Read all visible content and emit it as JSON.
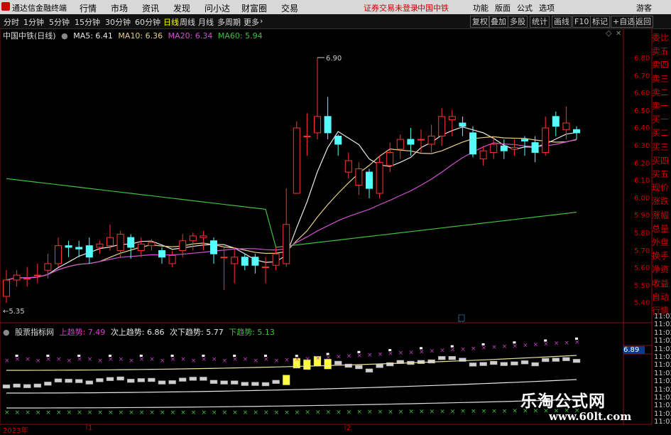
{
  "window": {
    "app_name": "通达信金融终端"
  },
  "menu": {
    "items": [
      "行情",
      "市场",
      "资讯",
      "发现",
      "问小达",
      "财富圈",
      "交易"
    ],
    "notice": "证券交易未登录",
    "stock": "中国中铁",
    "right": [
      "功能",
      "版面",
      "公式",
      "选项"
    ],
    "guest": "游客"
  },
  "toolbar": {
    "periods": [
      "分时",
      "1分钟",
      "5分钟",
      "15分钟",
      "30分钟",
      "60分钟",
      "日线",
      "周线",
      "月线",
      "多周期",
      "更多"
    ],
    "active_period": "日线",
    "right_buttons": [
      "复权",
      "叠加",
      "多股",
      "统计",
      "画线",
      "F10",
      "标记",
      "+自选",
      "返回"
    ]
  },
  "chart": {
    "stock_label": "中国中铁(日线)",
    "ma": [
      {
        "label": "MA5: 6.41",
        "color": "#e8e8e8"
      },
      {
        "label": "MA10: 6.36",
        "color": "#e6d08a"
      },
      {
        "label": "MA20: 6.34",
        "color": "#d050d0"
      },
      {
        "label": "MA60: 5.94",
        "color": "#40c040"
      }
    ],
    "high_label": "6.90",
    "low_label": "5.35",
    "event_mark": "解",
    "y_ticks": [
      "6.80",
      "6.70",
      "6.60",
      "6.50",
      "6.40",
      "6.30",
      "6.20",
      "6.10",
      "6.00",
      "5.90",
      "5.80",
      "5.70",
      "5.60",
      "5.50",
      "5.40"
    ]
  },
  "indicator": {
    "name": "股票指标网",
    "items": [
      {
        "label": "上趋势: 7.49",
        "color": "#d040d0"
      },
      {
        "label": "次上趋势: 6.86",
        "color": "#e8e8e8"
      },
      {
        "label": "次下趋势: 5.77",
        "color": "#e8e8e8"
      },
      {
        "label": "下趋势: 5.13",
        "color": "#40c040"
      }
    ],
    "cursor_value": "6.89"
  },
  "xaxis": {
    "labels": [
      "2023年",
      "1",
      "2"
    ]
  },
  "right_panel": {
    "items": [
      "委比",
      "卖五",
      "卖四",
      "卖三",
      "卖二",
      "卖一",
      "买一",
      "买二",
      "买三",
      "买四",
      "买五",
      "现价",
      "涨跌",
      "涨幅",
      "总量",
      "外盘",
      "换手",
      "净资",
      "收益",
      "自动",
      "行情"
    ],
    "times": [
      "11:02",
      "11:02",
      "11:02",
      "11:02",
      "11:02",
      "11:02",
      "11:02",
      "11:02",
      "11:02",
      "11:02",
      "11:02",
      "11:02",
      "11:02",
      "11:02"
    ]
  },
  "watermark": {
    "title": "乐淘公式网",
    "url": "www.60lt.com"
  },
  "chart_data": {
    "type": "candlestick",
    "ylim": [
      5.32,
      6.98
    ],
    "candles": [
      [
        5.42,
        5.52,
        5.58,
        5.38
      ],
      [
        5.52,
        5.55,
        5.58,
        5.48
      ],
      [
        5.53,
        5.53,
        5.6,
        5.48
      ],
      [
        5.55,
        5.55,
        5.62,
        5.5
      ],
      [
        5.58,
        5.62,
        5.68,
        5.53
      ],
      [
        5.62,
        5.73,
        5.78,
        5.6
      ],
      [
        5.73,
        5.72,
        5.76,
        5.66
      ],
      [
        5.72,
        5.71,
        5.76,
        5.66
      ],
      [
        5.73,
        5.66,
        5.78,
        5.62
      ],
      [
        5.72,
        5.74,
        5.76,
        5.68
      ],
      [
        5.73,
        5.78,
        5.86,
        5.7
      ],
      [
        5.7,
        5.8,
        5.82,
        5.66
      ],
      [
        5.78,
        5.72,
        5.8,
        5.65
      ],
      [
        5.7,
        5.74,
        5.78,
        5.66
      ],
      [
        5.73,
        5.75,
        5.77,
        5.7
      ],
      [
        5.7,
        5.66,
        5.72,
        5.62
      ],
      [
        5.62,
        5.67,
        5.7,
        5.6
      ],
      [
        5.7,
        5.76,
        5.8,
        5.66
      ],
      [
        5.76,
        5.79,
        5.81,
        5.7
      ],
      [
        5.78,
        5.79,
        5.82,
        5.7
      ],
      [
        5.76,
        5.68,
        5.78,
        5.62
      ],
      [
        5.66,
        5.66,
        5.72,
        5.46
      ],
      [
        5.62,
        5.66,
        5.72,
        5.5
      ],
      [
        5.66,
        5.61,
        5.68,
        5.58
      ],
      [
        5.66,
        5.61,
        5.68,
        5.56
      ],
      [
        5.6,
        5.6,
        5.66,
        5.5
      ],
      [
        5.61,
        5.68,
        5.72,
        5.58
      ],
      [
        5.62,
        5.86,
        6.08,
        5.6
      ],
      [
        6.05,
        6.45,
        6.49,
        6.06
      ],
      [
        6.4,
        6.4,
        6.54,
        6.28
      ],
      [
        6.42,
        6.52,
        6.88,
        6.38
      ],
      [
        6.52,
        6.42,
        6.64,
        6.38
      ],
      [
        6.4,
        6.35,
        6.41,
        6.28
      ],
      [
        6.18,
        6.25,
        6.3,
        6.14
      ],
      [
        6.1,
        6.2,
        6.24,
        6.04
      ],
      [
        6.18,
        6.08,
        6.2,
        6.02
      ],
      [
        6.05,
        6.24,
        6.28,
        6.02
      ],
      [
        6.22,
        6.3,
        6.36,
        6.18
      ],
      [
        6.32,
        6.38,
        6.41,
        6.26
      ],
      [
        6.38,
        6.35,
        6.45,
        6.28
      ],
      [
        6.38,
        6.38,
        6.44,
        6.3
      ],
      [
        6.35,
        6.4,
        6.47,
        6.3
      ],
      [
        6.4,
        6.52,
        6.57,
        6.34
      ],
      [
        6.5,
        6.52,
        6.56,
        6.4
      ],
      [
        6.48,
        6.46,
        6.52,
        6.4
      ],
      [
        6.42,
        6.29,
        6.46,
        6.27
      ],
      [
        6.26,
        6.31,
        6.34,
        6.22
      ],
      [
        6.3,
        6.35,
        6.4,
        6.26
      ],
      [
        6.34,
        6.31,
        6.38,
        6.26
      ],
      [
        6.32,
        6.33,
        6.38,
        6.28
      ],
      [
        6.38,
        6.37,
        6.4,
        6.28
      ],
      [
        6.36,
        6.3,
        6.4,
        6.24
      ],
      [
        6.3,
        6.45,
        6.52,
        6.28
      ],
      [
        6.52,
        6.46,
        6.55,
        6.4
      ],
      [
        6.44,
        6.48,
        6.58,
        6.38
      ],
      [
        6.44,
        6.42,
        6.46,
        6.38
      ]
    ]
  }
}
